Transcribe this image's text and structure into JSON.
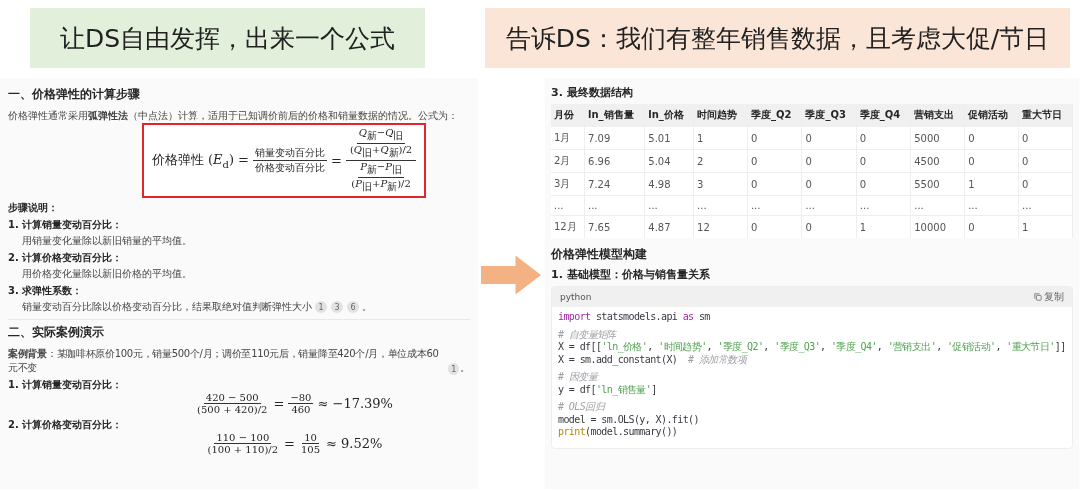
{
  "banners": [
    {
      "text": "让DS自由发挥，出来一个公式",
      "color": "#e2efda"
    },
    {
      "text": "告诉DS：我们有整年销售数据，且考虑大促/节日",
      "color": "#fbe5d6"
    }
  ],
  "left_doc": {
    "heading_1": "一、价格弹性的计算步骤",
    "intro": "价格弹性通常采用**弧弹性法**（中点法）计算，适用于已知调价前后的价格和销量数据的情况。公式为：",
    "formula": [
      {
        "kind": "text",
        "text": "价格弹性 (*E*$_{d}$) ="
      },
      {
        "kind": "frac",
        "num": [
          {
            "kind": "text",
            "text": "销量变动百分比"
          }
        ],
        "den": [
          {
            "kind": "text",
            "text": "价格变动百分比"
          }
        ]
      },
      {
        "kind": "text",
        "text": "="
      },
      {
        "kind": "frac",
        "num": [
          {
            "kind": "frac",
            "num": [
              {
                "kind": "text",
                "text": "*Q*$_{新}$−*Q*$_{旧}$"
              }
            ],
            "den": [
              {
                "kind": "text",
                "text": "(*Q*$_{旧}$+*Q*$_{新}$)/2"
              }
            ]
          }
        ],
        "den": [
          {
            "kind": "frac",
            "num": [
              {
                "kind": "text",
                "text": "*P*$_{新}$−*P*$_{旧}$"
              }
            ],
            "den": [
              {
                "kind": "text",
                "text": "(*P*$_{旧}$+*P*$_{新}$)/2"
              }
            ]
          }
        ]
      }
    ],
    "steps_label": "步骤说明：",
    "steps": [
      {
        "title": "1. 计算销量变动百分比：",
        "body": "用销量变化量除以新旧销量的平均值。"
      },
      {
        "title": "2. 计算价格变动百分比：",
        "body": "用价格变化量除以新旧价格的平均值。"
      },
      {
        "title": "3. 求弹性系数：",
        "body": "销量变动百分比除以价格变动百分比，结果取绝对值判断弹性大小",
        "citations": [
          "1",
          "3",
          "6"
        ],
        "tail": "。"
      }
    ],
    "heading_2": "二、实际案例演示",
    "case": {
      "text": "**案例背景**：某咖啡杯原价100元，销量500个/月；调价至110元后，销量降至420个/月，单位成本60元不变",
      "citations": [
        "1"
      ],
      "tail": "。"
    },
    "examples": [
      {
        "title": "1. 计算销量变动百分比：",
        "formula": [
          {
            "kind": "frac",
            "num": [
              {
                "kind": "text",
                "text": "420 − 500"
              }
            ],
            "den": [
              {
                "kind": "text",
                "text": "(500 + 420)/2"
              }
            ]
          },
          {
            "kind": "text",
            "text": "="
          },
          {
            "kind": "frac",
            "num": [
              {
                "kind": "text",
                "text": "−80"
              }
            ],
            "den": [
              {
                "kind": "text",
                "text": "460"
              }
            ]
          },
          {
            "kind": "text",
            "text": "≈ −17.39%"
          }
        ]
      },
      {
        "title": "2. 计算价格变动百分比：",
        "formula": [
          {
            "kind": "frac",
            "num": [
              {
                "kind": "text",
                "text": "110 − 100"
              }
            ],
            "den": [
              {
                "kind": "text",
                "text": "(100 + 110)/2"
              }
            ]
          },
          {
            "kind": "text",
            "text": "="
          },
          {
            "kind": "frac",
            "num": [
              {
                "kind": "text",
                "text": "10"
              }
            ],
            "den": [
              {
                "kind": "text",
                "text": "105"
              }
            ]
          },
          {
            "kind": "text",
            "text": "≈ 9.52%"
          }
        ]
      }
    ]
  },
  "right_doc": {
    "section_title": "3. 最终数据结构",
    "table": {
      "columns": [
        "月份",
        "ln_销售量",
        "ln_价格",
        "时间趋势",
        "季度_Q2",
        "季度_Q3",
        "季度_Q4",
        "营销支出",
        "促销活动",
        "重大节日"
      ],
      "rows": [
        [
          "1月",
          "7.09",
          "5.01",
          "1",
          "0",
          "0",
          "0",
          "5000",
          "0",
          "0"
        ],
        [
          "2月",
          "6.96",
          "5.04",
          "2",
          "0",
          "0",
          "0",
          "4500",
          "0",
          "0"
        ],
        [
          "3月",
          "7.24",
          "4.98",
          "3",
          "0",
          "0",
          "0",
          "5500",
          "1",
          "0"
        ],
        [
          "...",
          "...",
          "...",
          "...",
          "...",
          "...",
          "...",
          "...",
          "...",
          "..."
        ],
        [
          "12月",
          "7.65",
          "4.87",
          "12",
          "0",
          "0",
          "1",
          "10000",
          "0",
          "1"
        ]
      ]
    },
    "heading": "价格弹性模型构建",
    "subheading": "1. 基础模型：价格与销售量关系",
    "code": {
      "language": "python",
      "copy_label": "复制",
      "blocks": [
        [
          [
            {
              "kind": "keyword",
              "text": "import"
            },
            {
              "kind": "plain",
              "text": " statsmodels.api "
            },
            {
              "kind": "keyword",
              "text": "as"
            },
            {
              "kind": "plain",
              "text": " sm"
            }
          ]
        ],
        [
          [
            {
              "kind": "comment",
              "text": "# 自变量矩阵"
            }
          ],
          [
            {
              "kind": "plain",
              "text": "X = df[["
            },
            {
              "kind": "string",
              "text": "'ln_价格'"
            },
            {
              "kind": "plain",
              "text": ", "
            },
            {
              "kind": "string",
              "text": "'时间趋势'"
            },
            {
              "kind": "plain",
              "text": ", "
            },
            {
              "kind": "string",
              "text": "'季度_Q2'"
            },
            {
              "kind": "plain",
              "text": ", "
            },
            {
              "kind": "string",
              "text": "'季度_Q3'"
            },
            {
              "kind": "plain",
              "text": ", "
            },
            {
              "kind": "string",
              "text": "'季度_Q4'"
            },
            {
              "kind": "plain",
              "text": ", "
            },
            {
              "kind": "string",
              "text": "'营销支出'"
            },
            {
              "kind": "plain",
              "text": ", "
            },
            {
              "kind": "string",
              "text": "'促销活动'"
            },
            {
              "kind": "plain",
              "text": ", "
            },
            {
              "kind": "string",
              "text": "'重大节日'"
            },
            {
              "kind": "plain",
              "text": "]]"
            }
          ],
          [
            {
              "kind": "plain",
              "text": "X = sm.add_constant(X)  "
            },
            {
              "kind": "comment",
              "text": "# 添加常数项"
            }
          ]
        ],
        [
          [
            {
              "kind": "comment",
              "text": "# 因变量"
            }
          ],
          [
            {
              "kind": "plain",
              "text": "y = df["
            },
            {
              "kind": "string",
              "text": "'ln_销售量'"
            },
            {
              "kind": "plain",
              "text": "]"
            }
          ]
        ],
        [
          [
            {
              "kind": "comment",
              "text": "# OLS回归"
            }
          ],
          [
            {
              "kind": "plain",
              "text": "model = sm.OLS(y, X).fit()"
            }
          ],
          [
            {
              "kind": "builtin",
              "text": "print"
            },
            {
              "kind": "plain",
              "text": "(model.summary())"
            }
          ]
        ]
      ]
    }
  }
}
